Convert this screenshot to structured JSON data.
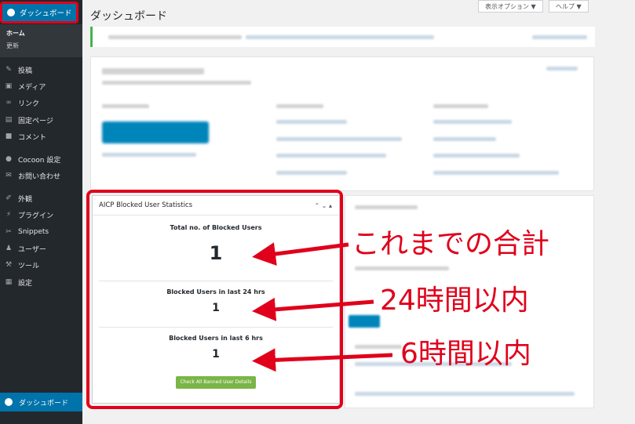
{
  "sidebar": {
    "dashboard_label": "ダッシュボード",
    "submenu": [
      "ホーム",
      "更新"
    ],
    "items": [
      {
        "label": "投稿",
        "icon": "pin-icon"
      },
      {
        "label": "メディア",
        "icon": "media-icon"
      },
      {
        "label": "リンク",
        "icon": "link-icon"
      },
      {
        "label": "固定ページ",
        "icon": "page-icon"
      },
      {
        "label": "コメント",
        "icon": "comment-icon"
      },
      {
        "label": "Cocoon 設定",
        "icon": "cocoon-icon"
      },
      {
        "label": "お問い合わせ",
        "icon": "mail-icon"
      },
      {
        "label": "外観",
        "icon": "appearance-icon"
      },
      {
        "label": "プラグイン",
        "icon": "plugin-icon"
      },
      {
        "label": "Snippets",
        "icon": "scissors-icon"
      },
      {
        "label": "ユーザー",
        "icon": "user-icon"
      },
      {
        "label": "ツール",
        "icon": "wrench-icon"
      },
      {
        "label": "設定",
        "icon": "settings-icon"
      }
    ],
    "bottom_label": "ダッシュボード"
  },
  "header": {
    "title": "ダッシュボード",
    "screen_options": "表示オプション ▼",
    "help": "ヘルプ ▼"
  },
  "widget": {
    "title": "AICP Blocked User Statistics",
    "controls": "⌃ ⌄ ▴",
    "stats": [
      {
        "label": "Total no. of Blocked Users",
        "value": "1"
      },
      {
        "label": "Blocked Users in last 24 hrs",
        "value": "1"
      },
      {
        "label": "Blocked Users in last 6 hrs",
        "value": "1"
      }
    ],
    "button": "Check All Banned User Details"
  },
  "annotations": [
    "これまでの合計",
    "24時間以内",
    "6時間以内"
  ],
  "colors": {
    "accent": "#0073aa",
    "annotation": "#e0001b",
    "button": "#7ab547",
    "sidebar": "#23282d"
  }
}
